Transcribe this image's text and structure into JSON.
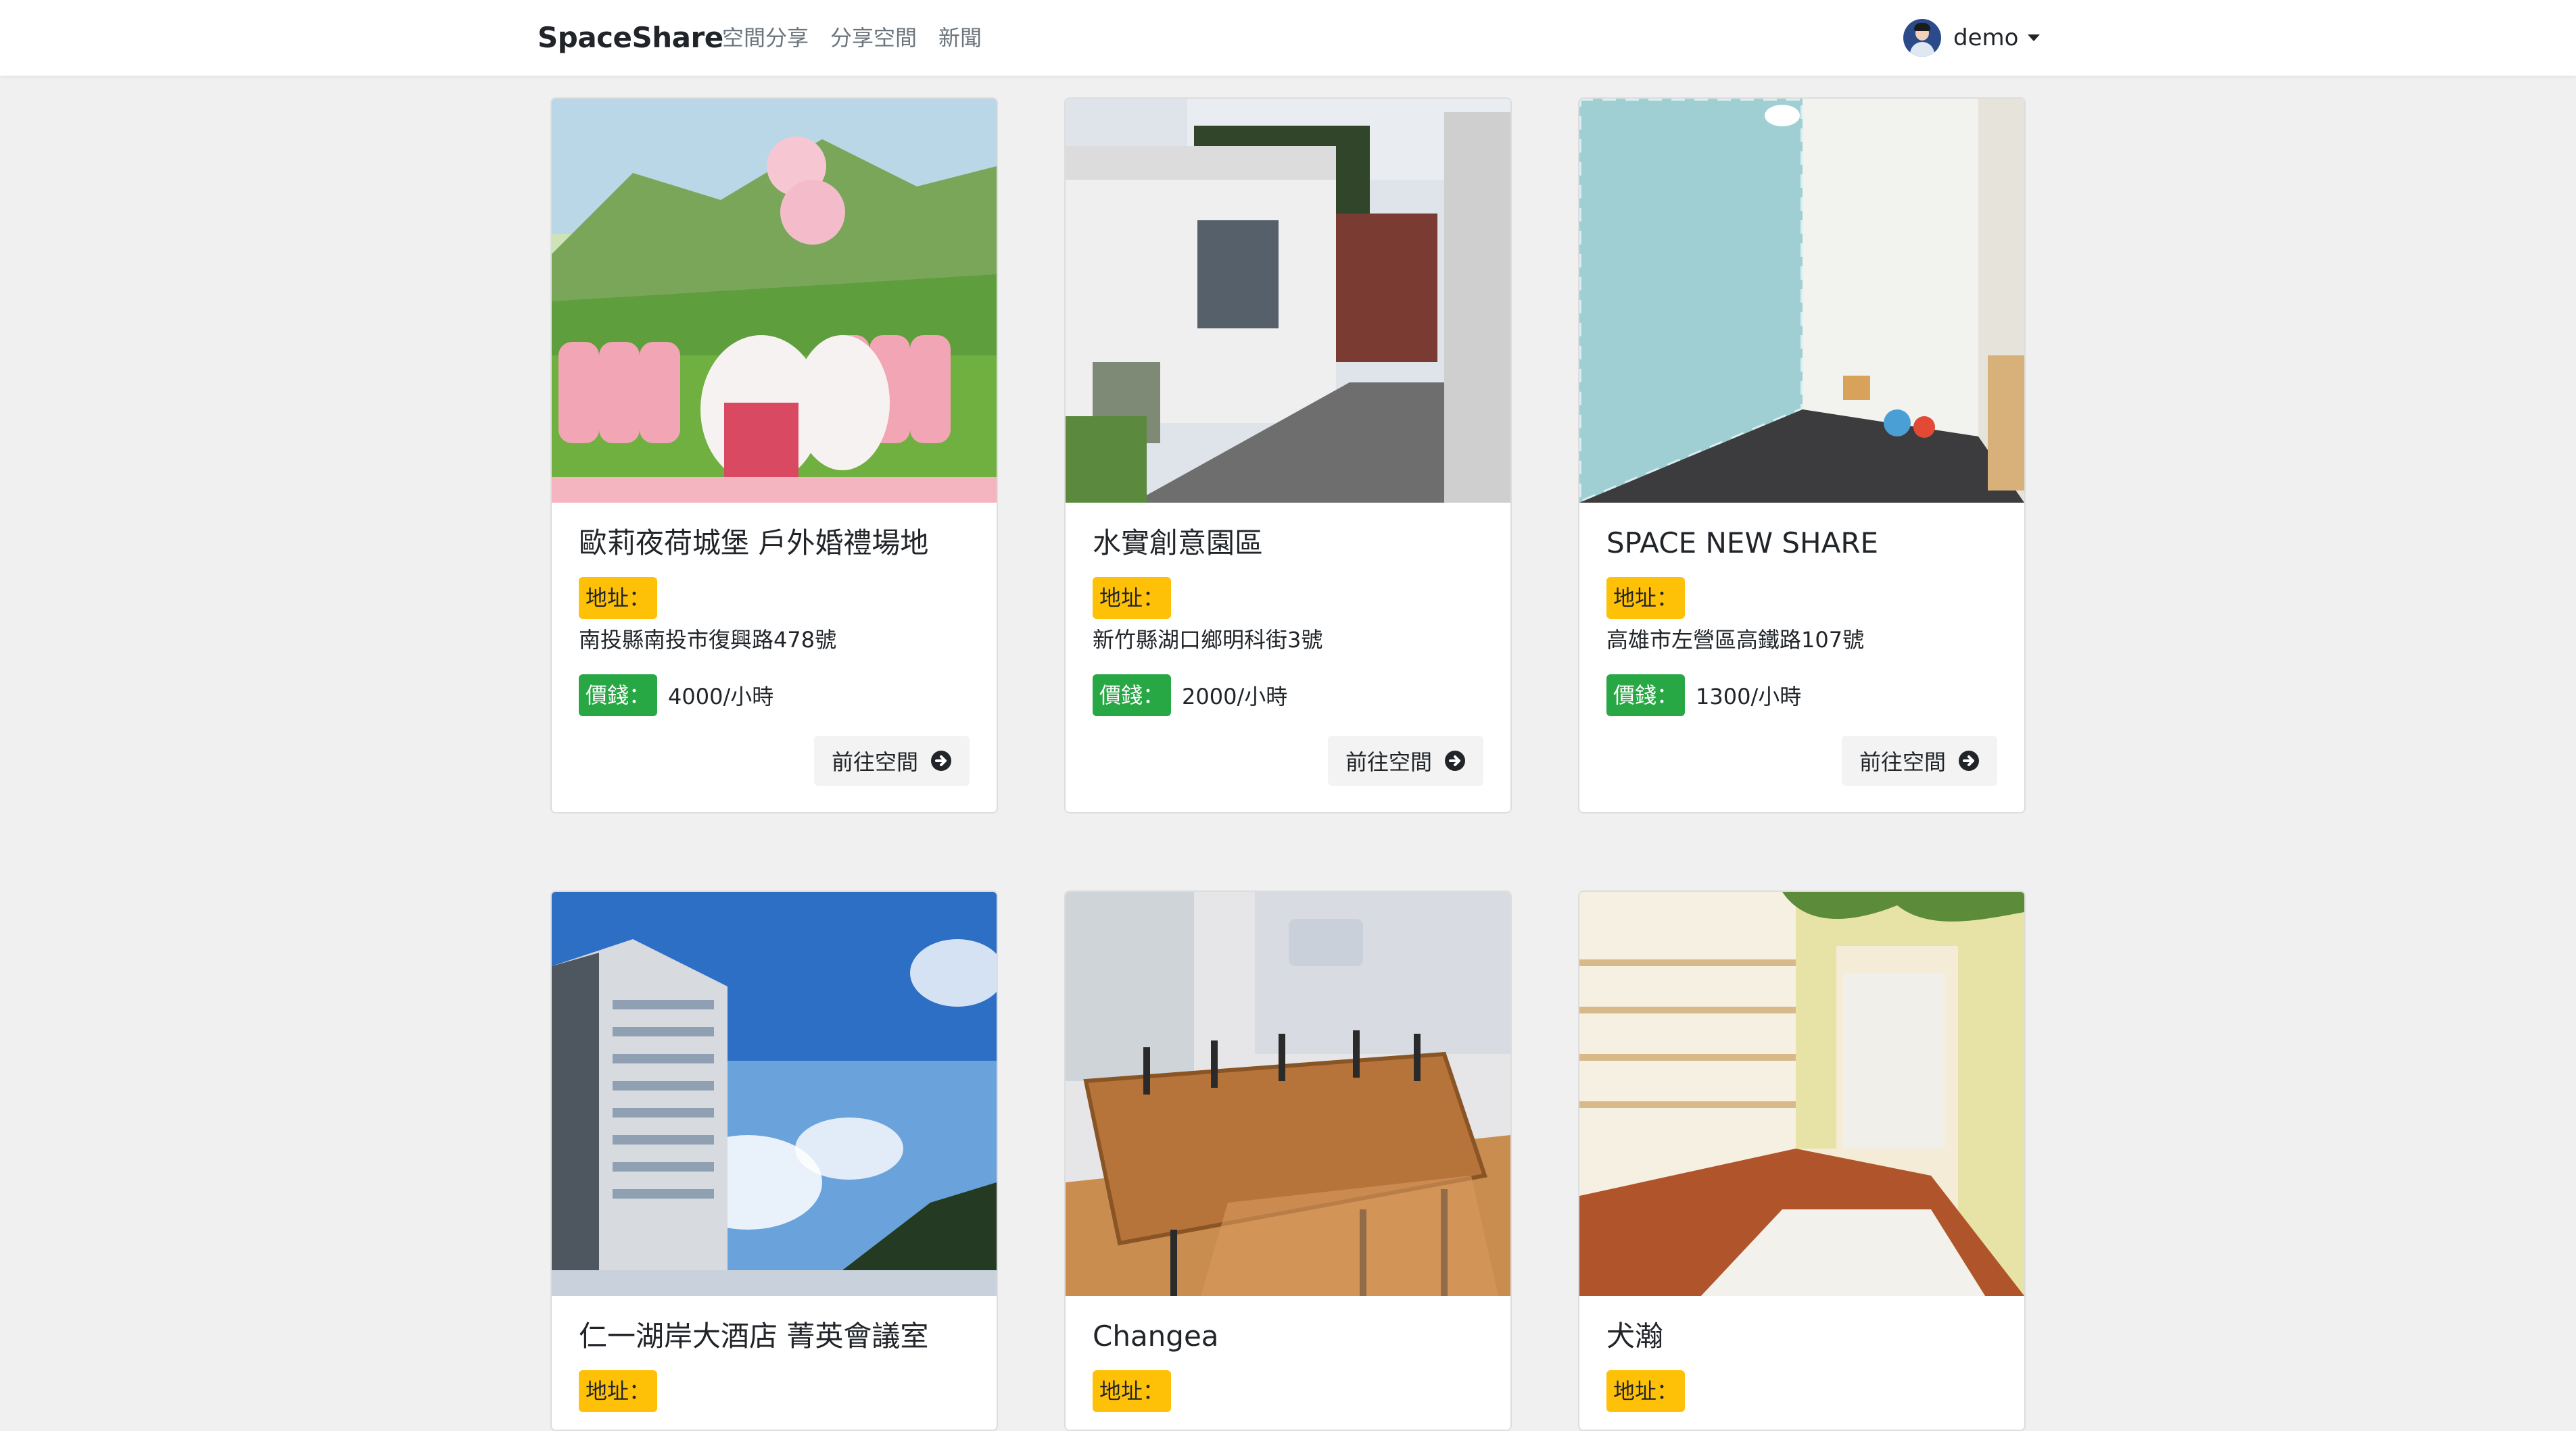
{
  "navbar": {
    "brand": "SpaceShare",
    "links": [
      "空間分享",
      "分享空間",
      "新聞"
    ],
    "user": "demo"
  },
  "labels": {
    "address": "地址：",
    "price": "價錢：",
    "goto": "前往空間"
  },
  "cards": [
    {
      "title": "歐莉夜荷城堡 戶外婚禮場地",
      "address": "南投縣南投市復興路478號",
      "price": "4000/小時"
    },
    {
      "title": "水實創意園區",
      "address": "新竹縣湖口鄉明科街3號",
      "price": "2000/小時"
    },
    {
      "title": "SPACE NEW SHARE",
      "address": "高雄市左營區高鐵路107號",
      "price": "1300/小時"
    },
    {
      "title": "仁一湖岸大酒店 菁英會議室"
    },
    {
      "title": "Changea"
    },
    {
      "title": "犬瀚"
    }
  ]
}
